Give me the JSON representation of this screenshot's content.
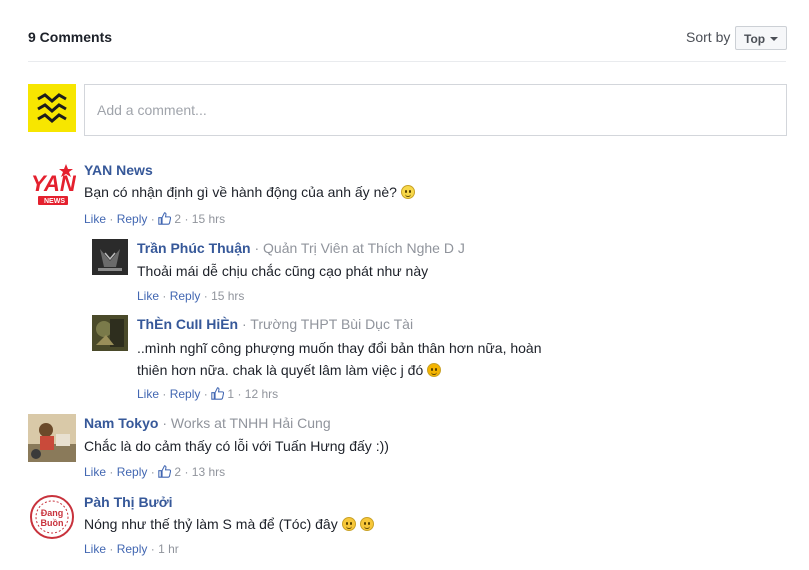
{
  "header": {
    "comment_count": "9 Comments",
    "sort_label": "Sort by",
    "sort_value": "Top"
  },
  "compose": {
    "placeholder": "Add a comment..."
  },
  "comments": [
    {
      "author": "YAN News",
      "byline": "",
      "text": "Bạn có nhận định gì về hành động của anh ấy nè?",
      "emoji": "smile-emoji",
      "like_label": "Like",
      "reply_label": "Reply",
      "likes": "2",
      "time": "15 hrs",
      "avatar_text": "YAN",
      "avatar_subtext": "NEWS"
    },
    {
      "author": "Trần Phúc Thuận",
      "byline": "· Quản Trị Viên at Thích Nghe D J",
      "text": "Thoải mái dễ chịu chắc cũng cạo phát như này",
      "like_label": "Like",
      "reply_label": "Reply",
      "likes": "",
      "time": "15 hrs"
    },
    {
      "author": "ThÈn CuII HiÈn",
      "byline": "· Trường THPT Bùi Dục Tài",
      "text_line1": "..mình nghĩ công phượng muốn thay đổi bản thân hơn nữa, hoàn",
      "text_line2": "thiên hơn nữa. chak là quyết lâm làm việc j đó",
      "emoji": "grin-emoji",
      "like_label": "Like",
      "reply_label": "Reply",
      "likes": "1",
      "time": "12 hrs"
    },
    {
      "author": "Nam Tokyo",
      "byline": "· Works at TNHH Hải Cung",
      "text": "Chắc là do cảm thấy có lỗi với Tuấn Hưng đấy :))",
      "like_label": "Like",
      "reply_label": "Reply",
      "likes": "2",
      "time": "13 hrs"
    },
    {
      "author": "Pàh Thị Bưởi",
      "byline": "",
      "text": "Nóng như thế thỷ làm S mà để (Tóc) đây",
      "emoji": "tongue-emoji",
      "like_label": "Like",
      "reply_label": "Reply",
      "likes": "",
      "time": "1 hr",
      "avatar_text_top": "Đang",
      "avatar_text_bottom": "Buồn"
    }
  ],
  "colors": {
    "link": "#365899",
    "action_link": "#4267b2",
    "meta": "#90949c",
    "brand_yellow": "#f7e600"
  }
}
